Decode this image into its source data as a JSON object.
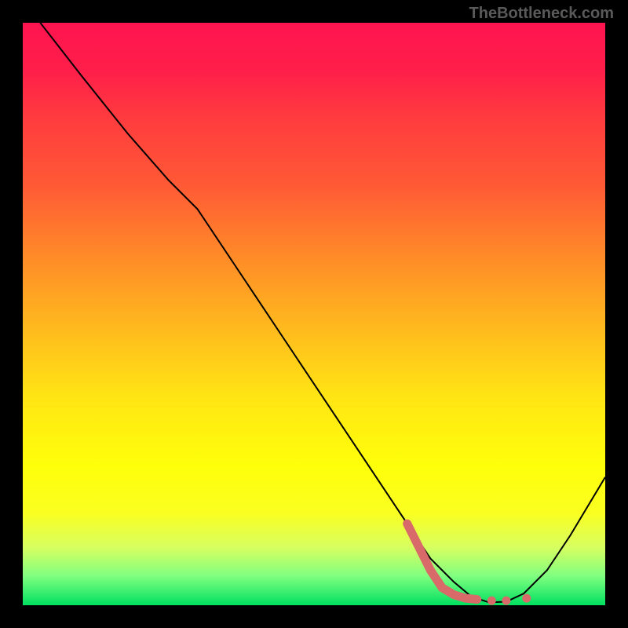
{
  "watermark": "TheBottleneck.com",
  "chart_data": {
    "type": "line",
    "title": "",
    "xlabel": "",
    "ylabel": "",
    "xlim": [
      0,
      100
    ],
    "ylim": [
      0,
      100
    ],
    "series": [
      {
        "name": "curve",
        "x": [
          3,
          10,
          18,
          25,
          30,
          38,
          46,
          54,
          60,
          66,
          70,
          74,
          77,
          80,
          83,
          86,
          90,
          94,
          100
        ],
        "y": [
          100,
          91,
          81,
          73,
          68,
          56,
          44,
          32,
          23,
          14,
          8,
          4,
          1.5,
          0.5,
          0.6,
          2,
          6,
          12,
          22
        ]
      },
      {
        "name": "highlight-segment",
        "x": [
          66,
          70,
          72,
          74,
          76,
          78
        ],
        "y": [
          14,
          6,
          3,
          1.8,
          1.2,
          1
        ]
      },
      {
        "name": "highlight-dots",
        "x": [
          80.5,
          83,
          86.5
        ],
        "y": [
          0.8,
          0.8,
          1.2
        ]
      }
    ],
    "colors": {
      "curve": "#000000",
      "highlight": "#d96a6a",
      "gradient_top": "#ff1450",
      "gradient_bottom": "#00e060"
    }
  }
}
